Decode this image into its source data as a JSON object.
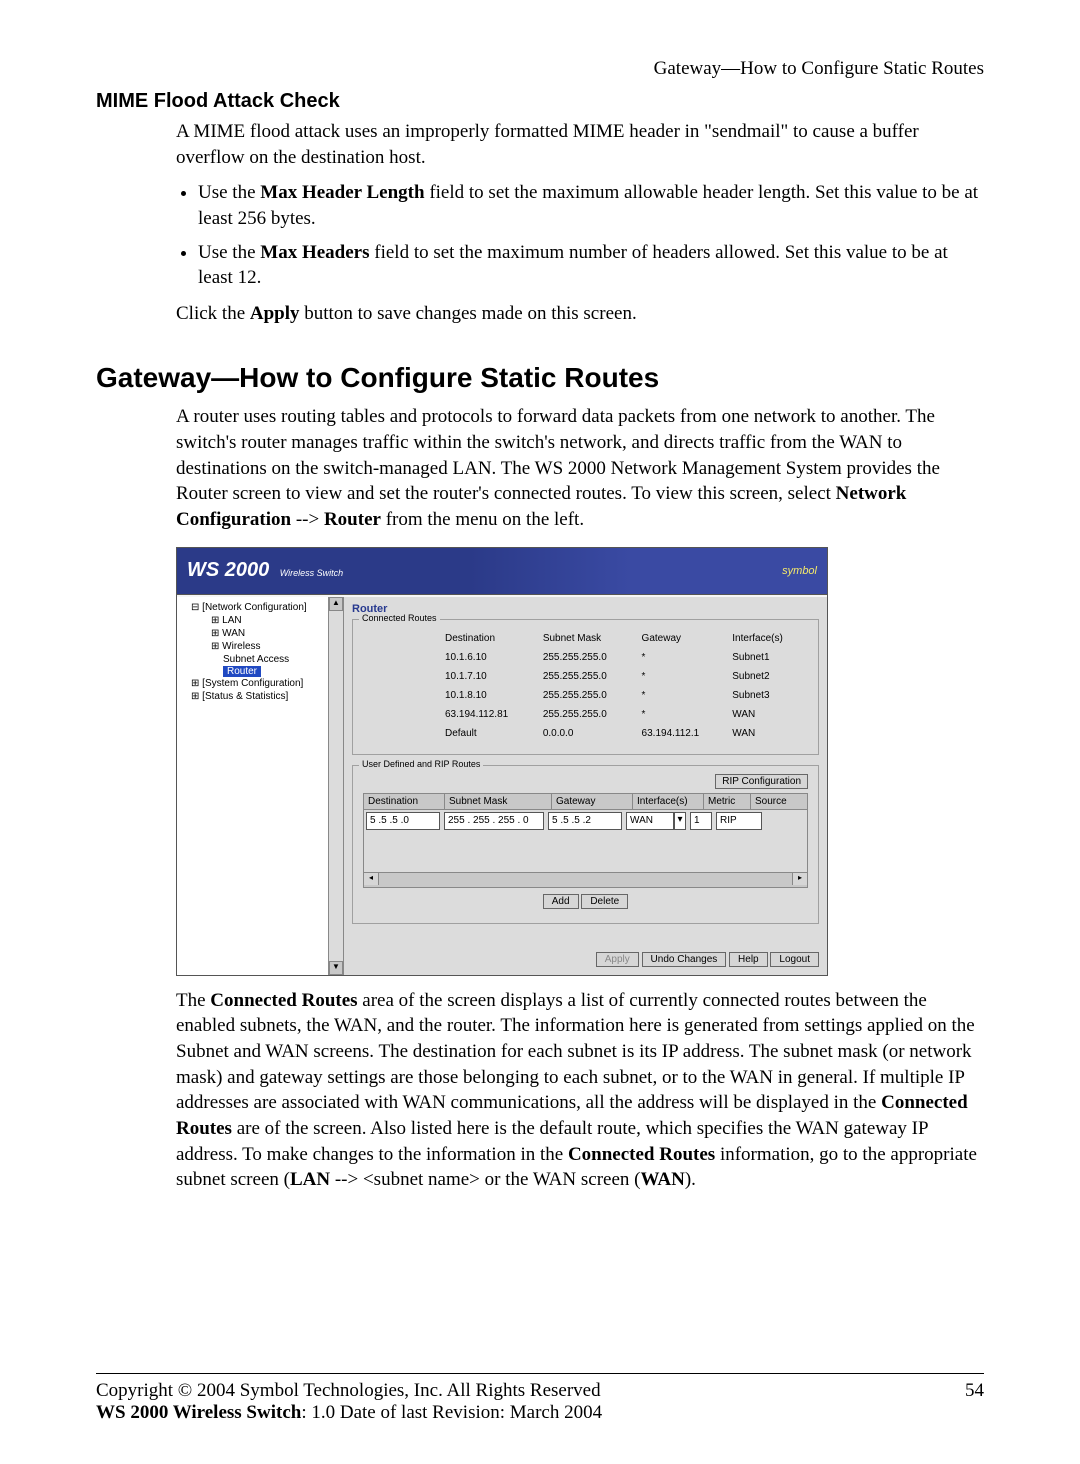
{
  "header_right": "Gateway—How to Configure Static Routes",
  "mime_title": "MIME Flood Attack Check",
  "mime_intro": "A MIME flood attack uses an improperly formatted MIME header in \"sendmail\" to cause a buffer overflow on the destination host.",
  "mime_b1_pre": "Use the ",
  "mime_b1_bold": "Max Header Length",
  "mime_b1_post": " field to set the maximum allowable header length. Set this value to be at least 256 bytes.",
  "mime_b2_pre": "Use the ",
  "mime_b2_bold": "Max Headers",
  "mime_b2_post": " field to set the maximum number of headers allowed. Set this value to be at least 12.",
  "mime_apply_pre": "Click the ",
  "mime_apply_bold": "Apply",
  "mime_apply_post": " button to save changes made on this screen.",
  "gateway_h": "Gateway—How to Configure Static Routes",
  "gw_p_pre": "A router uses routing tables and protocols to forward data packets from one network to another. The switch's router manages traffic within the switch's network, and directs traffic from the WAN to destinations on the switch-managed LAN. The WS 2000 Network Management System provides the Router screen to view and set the router's connected routes. To view this screen, select ",
  "gw_p_b1": "Network Configuration",
  "gw_p_mid": " --> ",
  "gw_p_b2": "Router",
  "gw_p_post": " from the menu on the left.",
  "banner_ws": "WS 2000",
  "banner_sub": "Wireless Switch",
  "banner_sym": "symbol",
  "nav": {
    "net": "[Network Configuration]",
    "lan": "LAN",
    "wan": "WAN",
    "wireless": "Wireless",
    "subnet": "Subnet Access",
    "router": "Router",
    "sys": "[System Configuration]",
    "stats": "[Status & Statistics]"
  },
  "router_title": "Router",
  "legend_connected": "Connected Routes",
  "legend_user": "User Defined and RIP Routes",
  "th": {
    "dest": "Destination",
    "mask": "Subnet Mask",
    "gw": "Gateway",
    "if": "Interface(s)",
    "metric": "Metric",
    "source": "Source"
  },
  "routes": [
    {
      "dest": "10.1.6.10",
      "mask": "255.255.255.0",
      "gw": "*",
      "if": "Subnet1"
    },
    {
      "dest": "10.1.7.10",
      "mask": "255.255.255.0",
      "gw": "*",
      "if": "Subnet2"
    },
    {
      "dest": "10.1.8.10",
      "mask": "255.255.255.0",
      "gw": "*",
      "if": "Subnet3"
    },
    {
      "dest": "63.194.112.81",
      "mask": "255.255.255.0",
      "gw": "*",
      "if": "WAN"
    },
    {
      "dest": "Default",
      "mask": "0.0.0.0",
      "gw": "63.194.112.1",
      "if": "WAN"
    }
  ],
  "rip_btn": "RIP Configuration",
  "ud": {
    "dest": "5 .5 .5 .0",
    "mask": "255 . 255 . 255 . 0",
    "gw": "5 .5 .5 .2",
    "if": "WAN",
    "metric": "1",
    "source": "RIP"
  },
  "btns": {
    "add": "Add",
    "delete": "Delete",
    "apply": "Apply",
    "undo": "Undo Changes",
    "help": "Help",
    "logout": "Logout"
  },
  "after": {
    "t1": "The ",
    "b1": "Connected Routes",
    "t2": " area of the screen displays a list of currently connected routes between the enabled subnets, the WAN, and the router. The information here is generated from settings applied on the Subnet and WAN screens. The destination for each subnet is its IP address. The subnet mask (or network mask) and gateway settings are those belonging to each subnet, or to the WAN in general. If multiple IP addresses are associated with WAN communications, all the address will be displayed in the ",
    "b2": "Connected Routes",
    "t3": " are of the screen. Also listed here is the default route, which specifies the WAN gateway IP address. To make changes to the information in the ",
    "b3": "Connected Routes",
    "t4": " information, go to the appropriate subnet screen (",
    "b4": "LAN",
    "t5": " --> <subnet name> or the WAN screen (",
    "b5": "WAN",
    "t6": ")."
  },
  "footer_copy": "Copyright © 2004 Symbol Technologies, Inc. All Rights Reserved",
  "footer_page": "54",
  "footer_line2_b": "WS 2000 Wireless Switch",
  "footer_line2_t": ": 1.0  Date of last Revision: March 2004"
}
